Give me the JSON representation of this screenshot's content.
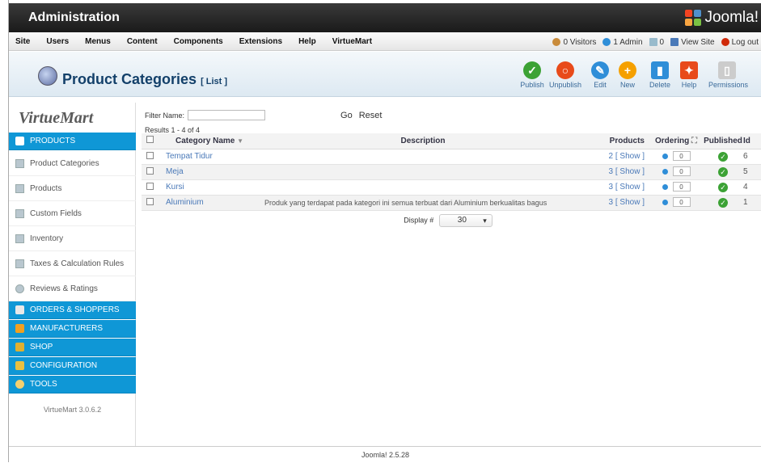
{
  "header": {
    "title": "Administration",
    "brand": "Joomla!"
  },
  "menu": [
    "Site",
    "Users",
    "Menus",
    "Content",
    "Components",
    "Extensions",
    "Help",
    "VirtueMart"
  ],
  "status": {
    "visitors": "0 Visitors",
    "admin": "1 Admin",
    "messages": "0",
    "view_site": "View Site",
    "logout": "Log out"
  },
  "page": {
    "title": "Product Categories",
    "subtitle": "[ List ]"
  },
  "toolbar": [
    {
      "label": "Publish",
      "color": "#3ca235",
      "glyph": "✓",
      "icon": "publish-icon"
    },
    {
      "label": "Unpublish",
      "color": "#e84a1a",
      "glyph": "○",
      "icon": "unpublish-icon"
    },
    {
      "label": "Edit",
      "color": "#2f8ed8",
      "glyph": "✎",
      "icon": "edit-icon"
    },
    {
      "label": "New",
      "color": "#f5a000",
      "glyph": "+",
      "icon": "new-icon"
    },
    {
      "label": "Delete",
      "color": "#2f8ed8",
      "glyph": "▮",
      "icon": "delete-icon"
    },
    {
      "label": "Help",
      "color": "#e84a1a",
      "glyph": "✦",
      "icon": "help-icon"
    },
    {
      "label": "Permissions",
      "color": "#bbbbbb",
      "glyph": "▯",
      "icon": "permissions-icon"
    }
  ],
  "sidebar": {
    "logo": {
      "a": "Virtue",
      "b": "Mart"
    },
    "products_header": "PRODUCTS",
    "items": [
      "Product Categories",
      "Products",
      "Custom Fields",
      "Inventory",
      "Taxes & Calculation Rules",
      "Reviews & Ratings"
    ],
    "sections": [
      "ORDERS & SHOPPERS",
      "MANUFACTURERS",
      "SHOP",
      "CONFIGURATION",
      "TOOLS"
    ],
    "version": "VirtueMart 3.0.6.2"
  },
  "filter": {
    "label": "Filter Name:",
    "value": "",
    "go": "Go",
    "reset": "Reset"
  },
  "results": "Results 1 - 4 of 4",
  "table": {
    "headers": {
      "name": "Category Name",
      "description": "Description",
      "products": "Products",
      "ordering": "Ordering",
      "published": "Published",
      "id": "Id"
    },
    "rows": [
      {
        "name": "Tempat Tidur",
        "description": "",
        "products": "2 [ Show ]",
        "ordering": "0",
        "id": "6"
      },
      {
        "name": "Meja",
        "description": "",
        "products": "3 [ Show ]",
        "ordering": "0",
        "id": "5"
      },
      {
        "name": "Kursi",
        "description": "",
        "products": "3 [ Show ]",
        "ordering": "0",
        "id": "4"
      },
      {
        "name": "Aluminium",
        "description": "Produk yang terdapat pada kategori ini semua terbuat dari Aluminium berkualitas bagus",
        "products": "3 [ Show ]",
        "ordering": "0",
        "id": "1"
      }
    ]
  },
  "display": {
    "label": "Display #",
    "value": "30"
  },
  "footer": "Joomla! 2.5.28",
  "colors": {
    "accent": "#0f97d6",
    "title": "#13406a",
    "published": "#3ca235"
  }
}
